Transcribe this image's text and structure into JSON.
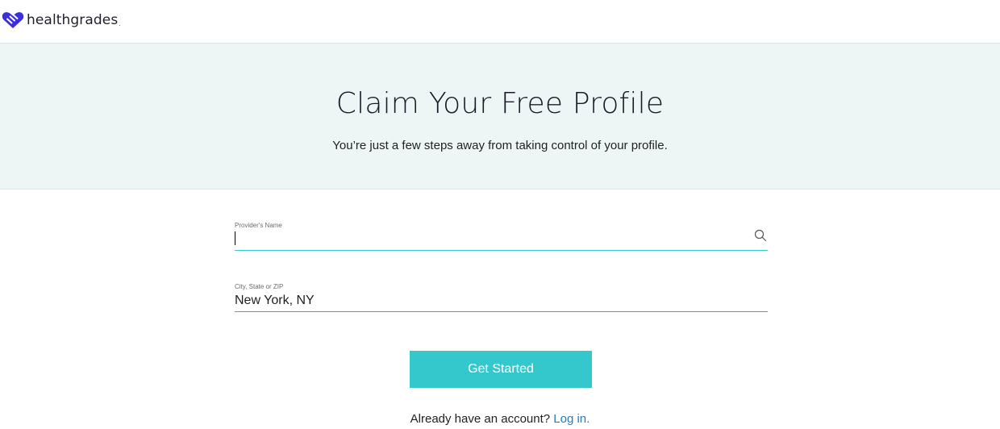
{
  "header": {
    "logo_text": "healthgrades",
    "logo_dot": ".",
    "brand_color": "#3b2fd9"
  },
  "hero": {
    "title": "Claim Your Free Profile",
    "subtitle": "You’re just a few steps away from taking control of your profile."
  },
  "form": {
    "provider": {
      "label": "Provider's Name",
      "value": "",
      "search_icon": "search-icon"
    },
    "location": {
      "label": "City, State or ZIP",
      "value": "New York, NY"
    },
    "submit_label": "Get Started",
    "accent_color": "#34c8cc"
  },
  "footer": {
    "prompt": "Already have an account?",
    "login_link": "Log in",
    "login_suffix": "."
  }
}
